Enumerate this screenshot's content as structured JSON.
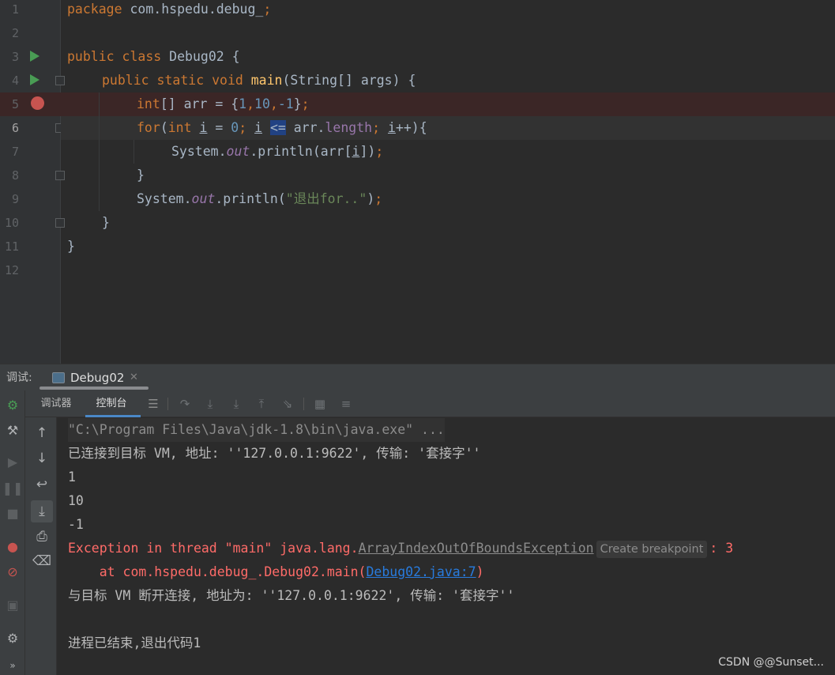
{
  "editor": {
    "lines": [
      {
        "num": "1"
      },
      {
        "num": "2"
      },
      {
        "num": "3"
      },
      {
        "num": "4"
      },
      {
        "num": "5"
      },
      {
        "num": "6"
      },
      {
        "num": "7"
      },
      {
        "num": "8"
      },
      {
        "num": "9"
      },
      {
        "num": "10"
      },
      {
        "num": "11"
      },
      {
        "num": "12"
      }
    ],
    "t": {
      "l1_kw": "package",
      "l1_rest": " com.hspedu.debug_",
      "l1_semi": ";",
      "l3_kw": "public class",
      "l3_rest": " Debug02 {",
      "l4_kw": "public static void",
      "l4_fn": "main",
      "l4_rest": "(String[] args) {",
      "l5_kw": "int",
      "l5_a": "[] arr = {",
      "l5_n1": "1",
      "l5_c1": ",",
      "l5_n2": "10",
      "l5_c2": ",",
      "l5_n3": "-1",
      "l5_b": "}",
      "l5_semi": ";",
      "l6_kw": "for",
      "l6_a": "(",
      "l6_kw2": "int",
      "l6_i1": "i",
      "l6_eq": " = ",
      "l6_n0": "0",
      "l6_s1": ";",
      "l6_i2": "i",
      "l6_op": "<=",
      "l6_arr": " arr.",
      "l6_len": "length",
      "l6_s2": ";",
      "l6_i3": "i",
      "l6_end": "++){",
      "l7_a": "System.",
      "l7_out": "out",
      "l7_b": ".println(arr[",
      "l7_i": "i",
      "l7_c": "])",
      "l7_semi": ";",
      "l8": "}",
      "l9_a": "System.",
      "l9_out": "out",
      "l9_b": ".println(",
      "l9_str": "\"退出for..\"",
      "l9_c": ")",
      "l9_semi": ";",
      "l10": "}",
      "l11": "}"
    }
  },
  "debug": {
    "title": "调试:",
    "tab_label": "Debug02",
    "tab_close": "✕",
    "subtabs": [
      "调试器",
      "控制台"
    ]
  },
  "icons": {
    "left_bar": [
      "bug-icon",
      "wrench-icon",
      "resume-icon",
      "pause-icon",
      "stop-icon",
      "view-breakpoints-icon",
      "mute-breakpoints-icon",
      "camera-icon",
      "settings-icon",
      "more-icon"
    ],
    "toolbar": [
      "menu-icon",
      "show-execution-point-icon",
      "step-over-icon",
      "step-into-icon",
      "step-out-icon",
      "run-to-cursor-icon",
      "evaluate-icon",
      "trace-icon"
    ],
    "console_bar": [
      "up-arrow-icon",
      "down-arrow-icon",
      "soft-wrap-icon",
      "scroll-to-end-icon",
      "print-icon",
      "trash-icon"
    ]
  },
  "console": {
    "cmd": "\"C:\\Program Files\\Java\\jdk-1.8\\bin\\java.exe\" ...",
    "connected": "已连接到目标 VM, 地址: ''127.0.0.1:9622', 传输: '套接字''",
    "out1": "1",
    "out2": "10",
    "out3": "-1",
    "exc_prefix": "Exception in thread \"main\" java.lang.",
    "exc_class": "ArrayIndexOutOfBoundsException",
    "exc_hint": "Create breakpoint",
    "exc_suffix": ": 3",
    "at_prefix": "    at com.hspedu.debug_.Debug02.main(",
    "at_link": "Debug02.java:7",
    "at_suffix": ")",
    "disconnected": "与目标 VM 断开连接, 地址为: ''127.0.0.1:9622', 传输: '套接字''",
    "exit": "进程已结束,退出代码1"
  },
  "watermark": "CSDN @@Sunset...",
  "colors": {
    "keyword": "#cc7832",
    "number": "#6897bb",
    "string": "#6a8759",
    "method": "#ffc66d",
    "error": "#ff6b68",
    "link": "#287bde"
  }
}
